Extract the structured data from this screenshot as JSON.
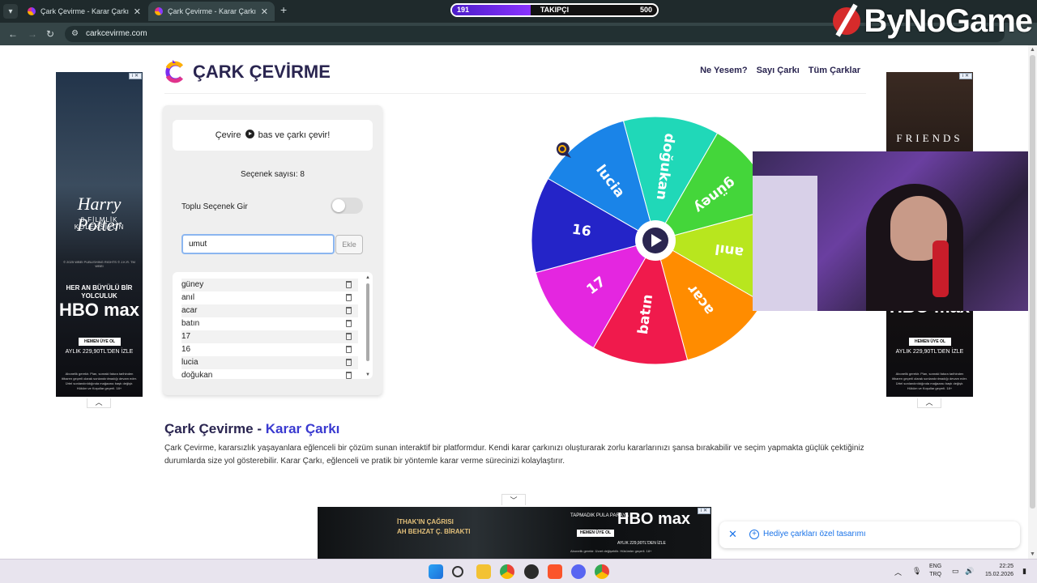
{
  "browser": {
    "tabs": [
      {
        "title": "Çark Çevirme - Karar Çarkı",
        "active": false
      },
      {
        "title": "Çark Çevirme - Karar Çarkı",
        "active": true
      }
    ],
    "url": "carkcevirme.com"
  },
  "stream_overlay": {
    "followers_current": "191",
    "followers_label": "TAKIPÇI",
    "followers_goal": "500",
    "followers_progress": 0.382,
    "brand": "ByNoGame"
  },
  "site": {
    "title": "ÇARK ÇEVİRME",
    "nav": [
      "Ne Yesem?",
      "Sayı Çarkı",
      "Tüm Çarklar"
    ]
  },
  "panel": {
    "hint_before": "Çevire",
    "hint_after": "bas ve çarkı çevir!",
    "option_count": "Seçenek sayısı: 8",
    "bulk_label": "Toplu Seçenek Gir",
    "bulk_enabled": false,
    "input_value": "umut",
    "add_label": "Ekle",
    "options": [
      "güney",
      "anıl",
      "acar",
      "batın",
      "17",
      "16",
      "lucia",
      "doğukan"
    ]
  },
  "wheel": {
    "segments": [
      {
        "label": "doğukan",
        "color": "#20d8b8"
      },
      {
        "label": "güney",
        "color": "#44d63a"
      },
      {
        "label": "anıl",
        "color": "#b8e61e"
      },
      {
        "label": "acar",
        "color": "#ff8c00"
      },
      {
        "label": "batın",
        "color": "#f01a4c"
      },
      {
        "label": "17",
        "color": "#e426e0"
      },
      {
        "label": "16",
        "color": "#2424c8"
      },
      {
        "label": "lucia",
        "color": "#1a84e8"
      }
    ]
  },
  "ads": {
    "left": {
      "movie": "Harry Potter",
      "movie_sub": "8 FİLMLİK KOLEKSİYON",
      "legal": "© 2025 WBEI PUBLISHING RIGHTS © J.K.R. TM WBEI",
      "slogan": "HER AN BÜYÜLÜ BİR YOLCULUK",
      "hbo": "HBO max",
      "cta": "HEMEN ÜYE OL",
      "price": "AYLIK 229,90TL'DEN İZLE",
      "fine": "Abonelik gerekir. Plan, sonraki fatura tarihinden itibaren geçerli olarak sonlandırılmadığı devam eder. Ürtel sonlandırıldığında mağazası baştı değişir. Hüküm ve Koşullar geçerli. 18+"
    },
    "right": {
      "show": "FRIENDS",
      "hbo": "HBO max",
      "cta": "HEMEN ÜYE OL",
      "price": "AYLIK 229,90TL'DEN İZLE",
      "fine": "Abonelik gerekir. Plan, sonraki fatura tarihinden itibaren geçerli olarak sonlandırılmadığı devam eder. Ürtel sonlandırıldığında mağazası baştı değişir. Hüküm ve Koşullar geçerli. 18+"
    },
    "bottom": {
      "line1": "İTHAK'IN ÇAĞRISI",
      "line2": "AH BEHZAT Ç. BİRAKTI",
      "tag": "TAPMADIK PULA PARAYA",
      "hbo": "HBO max",
      "cta": "HEMEN ÜYE OL",
      "price": "AYLIK 229,90TL'DEN İZLE",
      "fine": "Abonelik gerekir. Ücret değişebilir. Hükümler geçerli. 18+"
    }
  },
  "section": {
    "title_a": "Çark Çevirme - ",
    "title_b": "Karar Çarkı",
    "text": "Çark Çevirme, kararsızlık yaşayanlara eğlenceli bir çözüm sunan interaktif bir platformdur. Kendi karar çarkınızı oluşturarak zorlu kararlarınızı şansa bırakabilir ve seçim yapmakta güçlük çektiğiniz durumlarda size yol gösterebilir. Karar Çarkı, eğlenceli ve pratik bir yöntemle karar verme sürecinizi kolaylaştırır."
  },
  "custom_banner": {
    "label": "Hediye çarkları özel tasarımı"
  },
  "taskbar": {
    "lang_top": "ENG",
    "lang_bottom": "TRQ",
    "time": "22:25",
    "date": "15.02.2026"
  }
}
